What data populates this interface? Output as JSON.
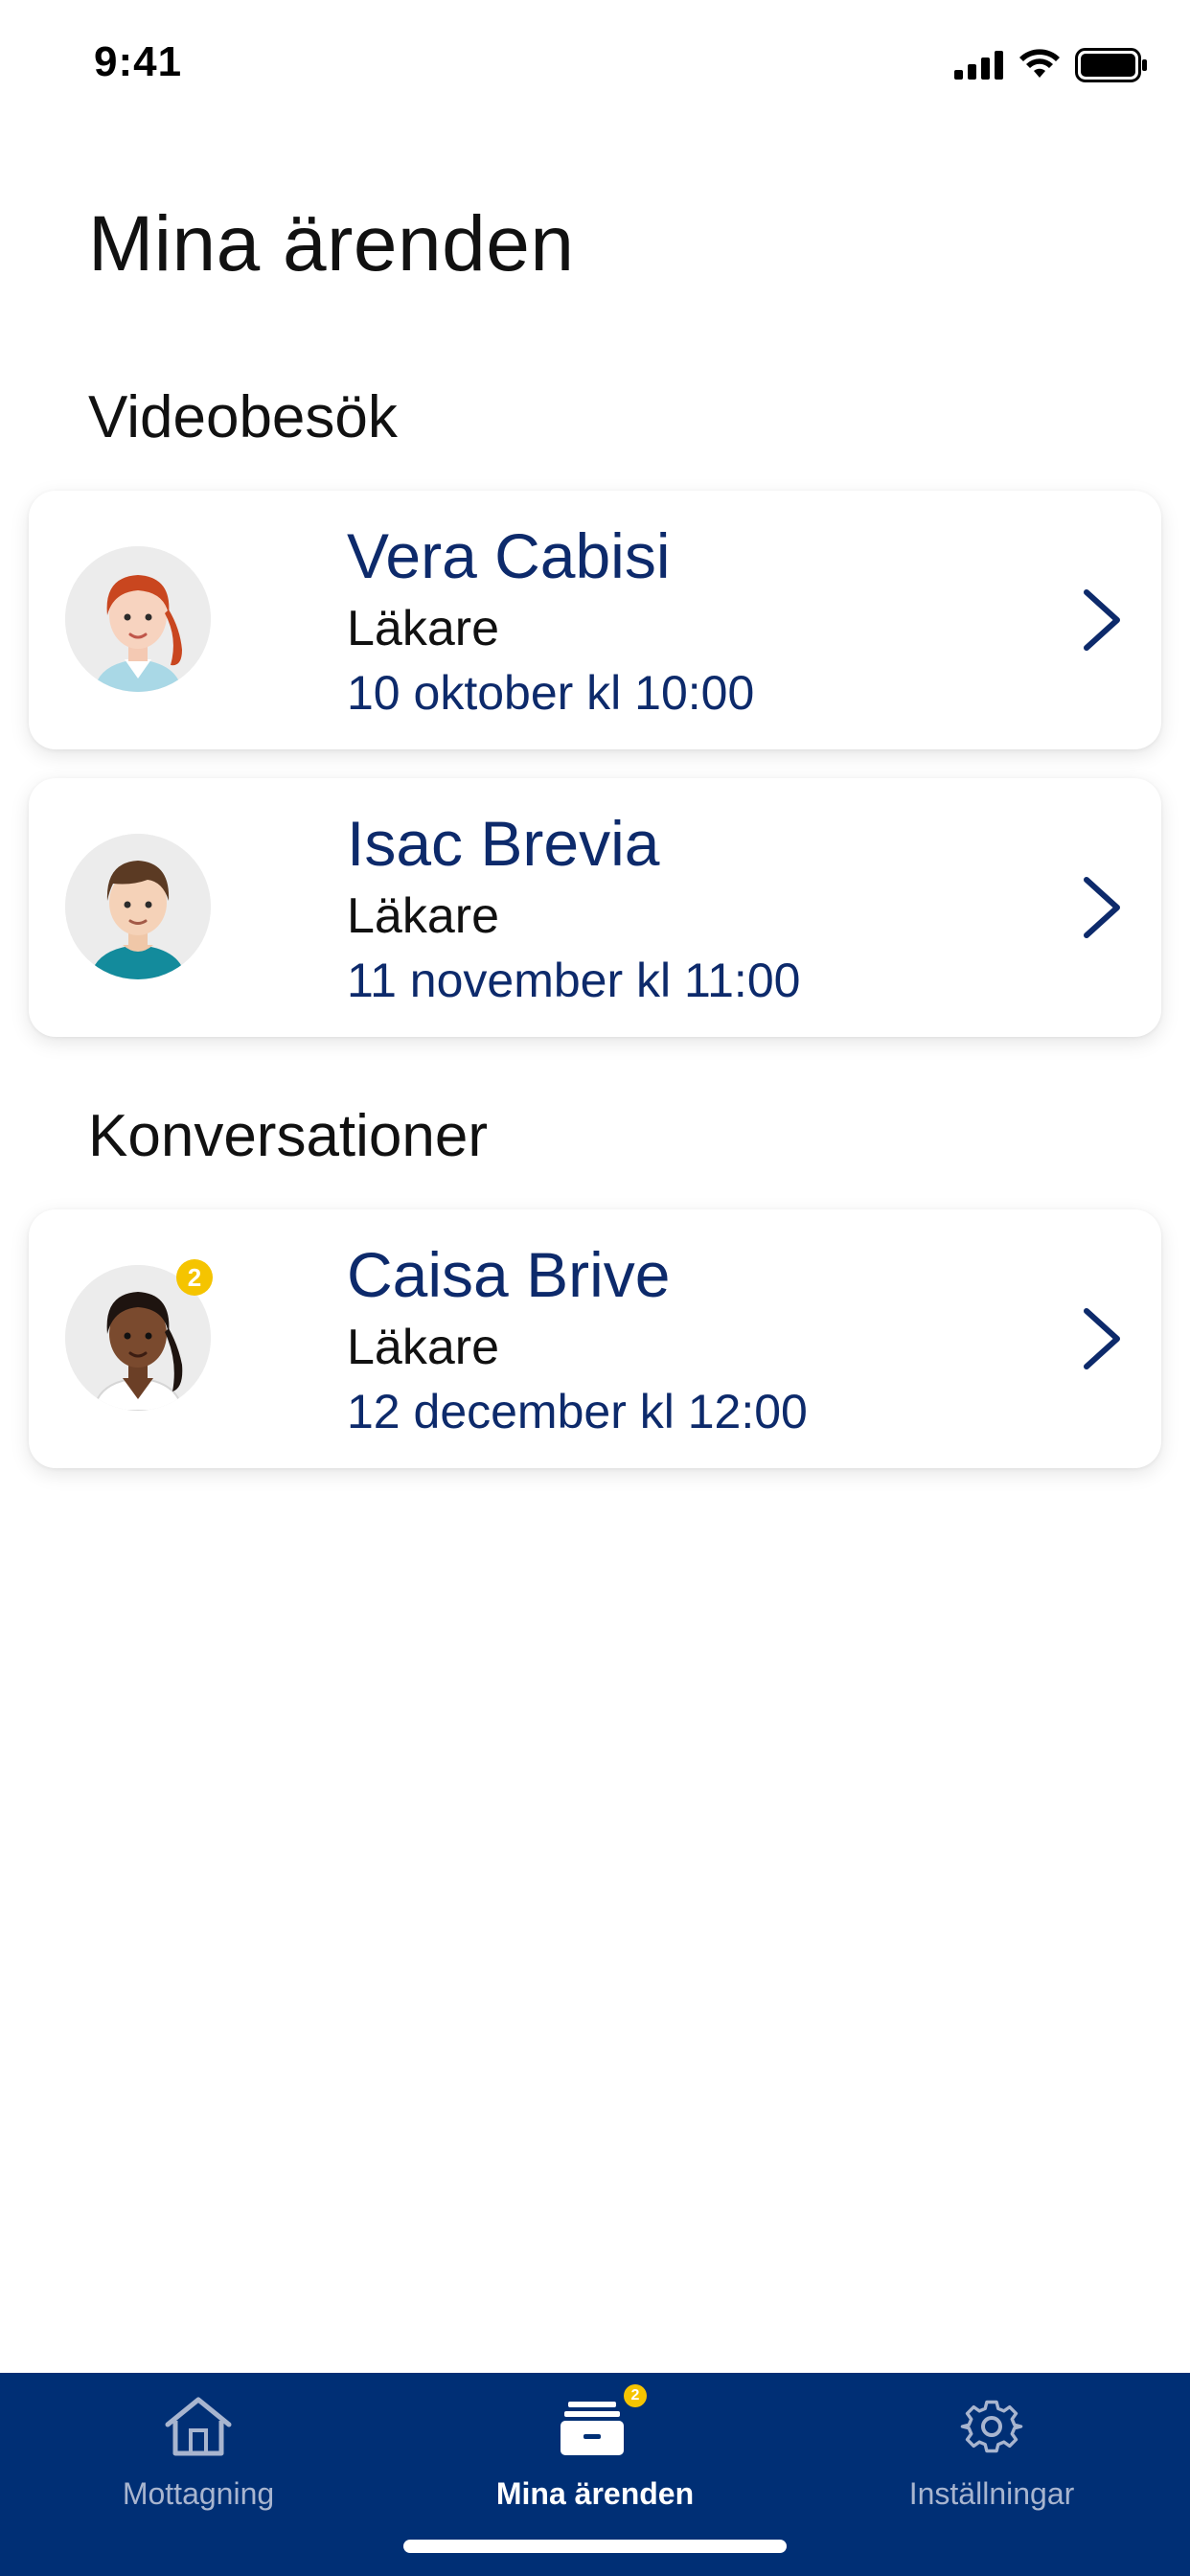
{
  "status_bar": {
    "time": "9:41",
    "icons": [
      "signal-icon",
      "wifi-icon",
      "battery-icon"
    ]
  },
  "page": {
    "title": "Mina ärenden"
  },
  "sections": [
    {
      "title": "Videobesök",
      "items": [
        {
          "name": "Vera Cabisi",
          "role": "Läkare",
          "date": "10 oktober kl 10:00",
          "avatar": "female-doctor-red-hair-avatar"
        },
        {
          "name": "Isac Brevia",
          "role": "Läkare",
          "date": "11 november kl 11:00",
          "avatar": "male-doctor-avatar"
        }
      ]
    },
    {
      "title": "Konversationer",
      "items": [
        {
          "name": "Caisa Brive",
          "role": "Läkare",
          "date": "12 december kl 12:00",
          "avatar": "female-doctor-dark-hair-avatar",
          "badge": "2"
        }
      ]
    }
  ],
  "tab_bar": {
    "tabs": [
      {
        "label": "Mottagning",
        "icon": "home-icon",
        "active": false
      },
      {
        "label": "Mina ärenden",
        "icon": "inbox-tray-icon",
        "active": true,
        "badge": "2"
      },
      {
        "label": "Inställningar",
        "icon": "gear-icon",
        "active": false
      }
    ]
  },
  "colors": {
    "brand_navy": "#002f75",
    "text_navy": "#0d2a6b",
    "badge_yellow": "#f5c400",
    "inactive_tab_label": "#a8b5cf"
  }
}
